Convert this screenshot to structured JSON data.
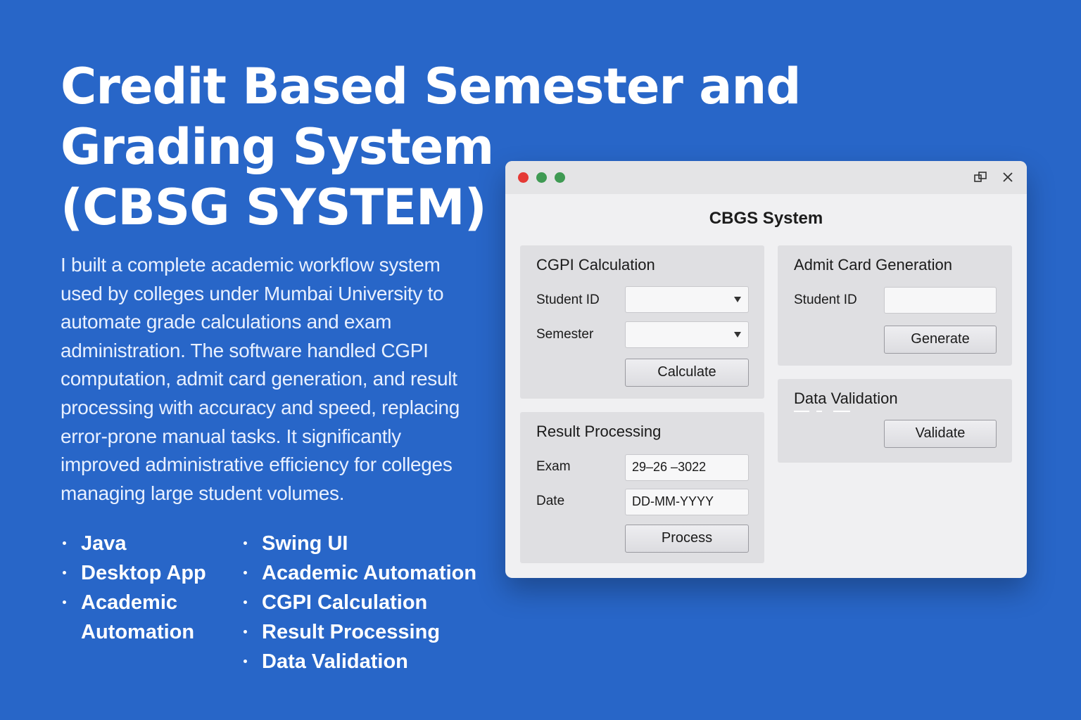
{
  "hero": {
    "title_lines": [
      "Credit Based Semester and",
      "Grading System",
      "(CBSG SYSTEM)"
    ],
    "description_lines": [
      "I built a complete academic workflow system",
      "used by colleges under Mumbai University to",
      "automate grade calculations and exam",
      "administration. The software handled CGPI",
      "computation, admit card generation, and result",
      "processing with accuracy and speed, replacing",
      "error-prone manual tasks. It significantly",
      "improved administrative efficiency for colleges",
      "managing large student volumes."
    ],
    "bullets_left": [
      "Java",
      "Desktop App",
      "Academic Automation"
    ],
    "bullets_right": [
      "Swing UI",
      "Academic Automation",
      "CGPI Calculation",
      "Result Processing",
      "Data Validation"
    ]
  },
  "window": {
    "title": "CBGS System",
    "controls": {
      "close_color": "#e53935",
      "dot_color": "#3f9a53",
      "restore_icon": "restore-icon",
      "close_icon": "close-icon"
    },
    "cgpi": {
      "title": "CGPI Calculation",
      "student_id_label": "Student ID",
      "student_id_value": "",
      "semester_label": "Semester",
      "semester_value": "",
      "button": "Calculate"
    },
    "admit": {
      "title": "Admit Card Generation",
      "student_id_label": "Student ID",
      "student_id_value": "",
      "button": "Generate"
    },
    "result": {
      "title": "Result Processing",
      "exam_label": "Exam",
      "exam_value": "29–26 –3022",
      "date_label": "Date",
      "date_value": "DD-MM-YYYY",
      "button": "Process"
    },
    "validation": {
      "title": "Data Validation",
      "button": "Validate"
    }
  },
  "colors": {
    "background": "#2866c8",
    "window_bg": "#f0f0f2",
    "panel_bg": "#dfdfe2"
  }
}
